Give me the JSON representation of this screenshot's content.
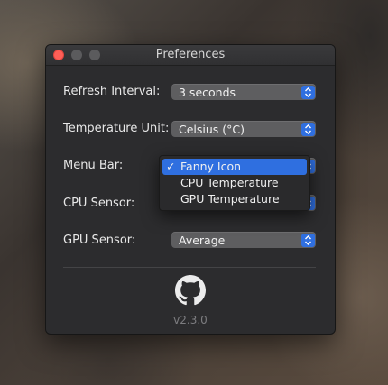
{
  "window": {
    "title": "Preferences"
  },
  "settings": [
    {
      "label": "Refresh Interval:",
      "value": "3 seconds"
    },
    {
      "label": "Temperature Unit:",
      "value": "Celsius (°C)"
    },
    {
      "label": "Menu Bar:",
      "value": ""
    },
    {
      "label": "CPU Sensor:",
      "value": ""
    },
    {
      "label": "GPU Sensor:",
      "value": "Average"
    }
  ],
  "menu_bar_dropdown": {
    "items": [
      {
        "label": "Fanny Icon",
        "checked": true
      },
      {
        "label": "CPU Temperature",
        "checked": false
      },
      {
        "label": "GPU Temperature",
        "checked": false
      }
    ],
    "check_mark": "✓"
  },
  "footer": {
    "version": "v2.3.0",
    "icon": "github-icon"
  },
  "colors": {
    "accent": "#2f6fe0",
    "window_bg": "#2c2c2e",
    "close": "#ff5f57"
  }
}
